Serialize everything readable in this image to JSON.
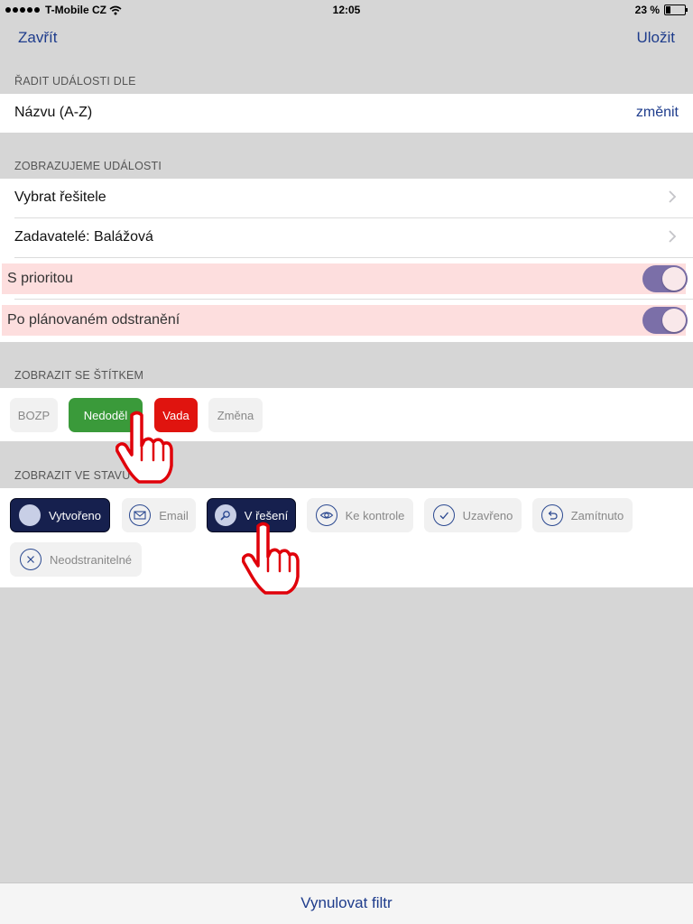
{
  "status_bar": {
    "carrier": "T-Mobile CZ",
    "time": "12:05",
    "battery": "23 %",
    "battery_level": 0.23
  },
  "nav": {
    "close_label": "Zavřít",
    "save_label": "Uložit"
  },
  "sort_section": {
    "header": "ŘADIT UDÁLOSTI DLE",
    "value": "Názvu (A-Z)",
    "change_label": "změnit"
  },
  "display_section": {
    "header": "ZOBRAZUJEME UDÁLOSTI",
    "rows": [
      {
        "label": "Vybrat řešitele"
      },
      {
        "label": "Zadavatelé: Balážová"
      }
    ],
    "toggles": [
      {
        "label": "S prioritou",
        "on": true
      },
      {
        "label": "Po plánovaném odstranění",
        "on": true
      }
    ]
  },
  "tag_section": {
    "header": "ZOBRAZIT SE ŠTÍTKEM",
    "tags": [
      {
        "label": "BOZP",
        "style": "plain"
      },
      {
        "label": "Nedoděl",
        "style": "green"
      },
      {
        "label": "Vada",
        "style": "red"
      },
      {
        "label": "Změna",
        "style": "plain"
      }
    ]
  },
  "state_section": {
    "header": "ZOBRAZIT VE STAVU",
    "states": [
      {
        "label": "Vytvořeno",
        "icon": "circle-icon",
        "selected": true
      },
      {
        "label": "Email",
        "icon": "envelope-icon",
        "selected": false
      },
      {
        "label": "V řešení",
        "icon": "wrench-icon",
        "selected": true
      },
      {
        "label": "Ke kontrole",
        "icon": "eye-icon",
        "selected": false
      },
      {
        "label": "Uzavřeno",
        "icon": "checkmark-icon",
        "selected": false
      },
      {
        "label": "Zamítnuto",
        "icon": "undo-arrow-icon",
        "selected": false
      },
      {
        "label": "Neodstranitelné",
        "icon": "x-icon",
        "selected": false
      }
    ]
  },
  "footer": {
    "reset_label": "Vynulovat filtr"
  },
  "colors": {
    "accent": "#1e3c8c",
    "toggle_on": "#7b6fa8",
    "highlight": "#fddede",
    "tag_green": "#3a9a3a",
    "tag_red": "#e0140f",
    "state_selected": "#16204e",
    "pointer_hand": "#e0000a"
  }
}
